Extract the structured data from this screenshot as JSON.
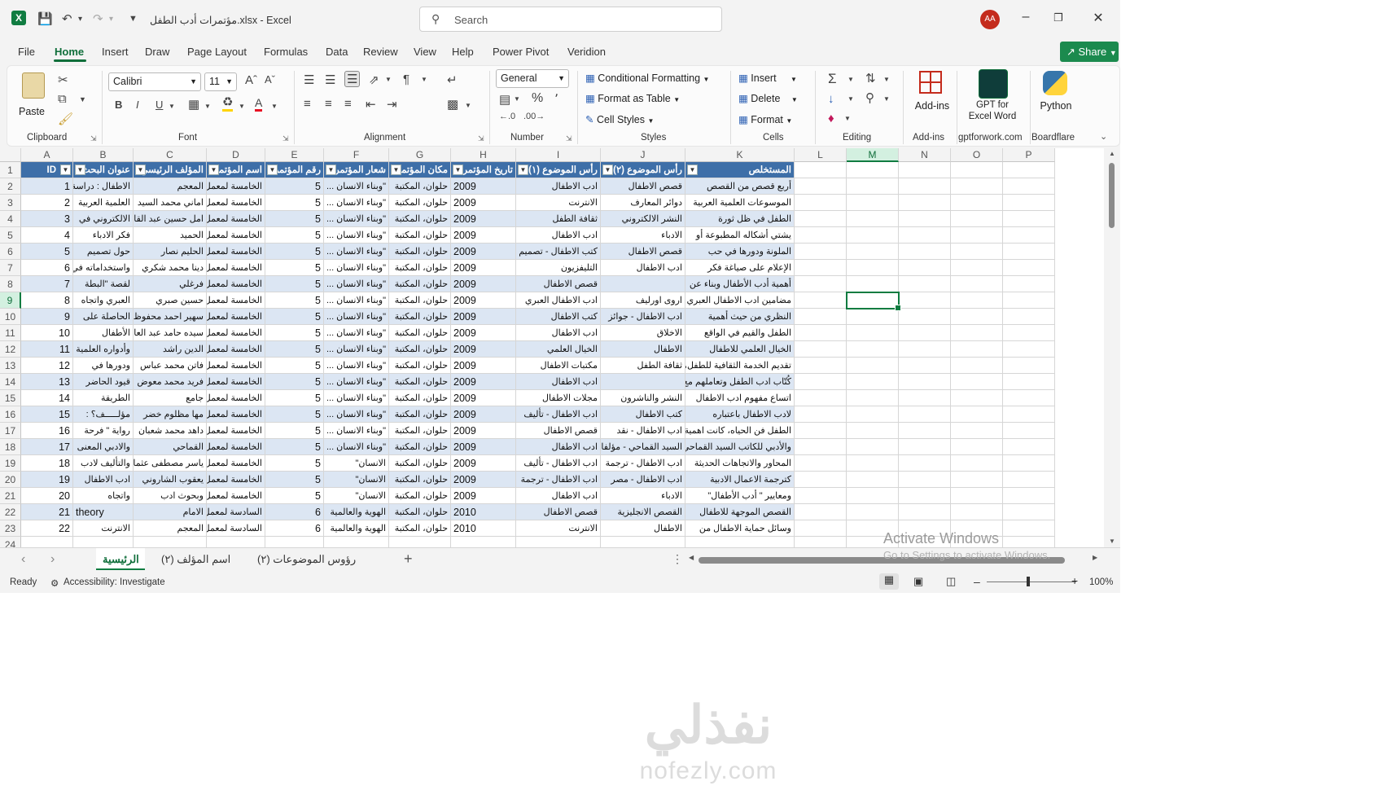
{
  "titlebar": {
    "title": "مؤتمرات أدب الطفل.xlsx  -  Excel",
    "search_placeholder": "Search",
    "avatar_initials": "AA"
  },
  "menu": [
    "File",
    "Home",
    "Insert",
    "Draw",
    "Page Layout",
    "Formulas",
    "Data",
    "Review",
    "View",
    "Help",
    "Power Pivot",
    "Veridion"
  ],
  "share_label": "Share",
  "ribbon": {
    "clipboard": {
      "paste": "Paste",
      "label": "Clipboard"
    },
    "font": {
      "name": "Calibri",
      "size": "11",
      "label": "Font"
    },
    "alignment": {
      "label": "Alignment"
    },
    "number": {
      "format": "General",
      "label": "Number"
    },
    "styles": {
      "conditional": "Conditional Formatting",
      "format_table": "Format as Table",
      "cell_styles": "Cell Styles",
      "label": "Styles"
    },
    "cells": {
      "insert": "Insert",
      "delete": "Delete",
      "format": "Format",
      "label": "Cells"
    },
    "editing": {
      "label": "Editing"
    },
    "addins": {
      "btn": "Add-ins",
      "label": "Add-ins"
    },
    "gpt": {
      "line1": "GPT for",
      "line2": "Excel Word",
      "label": "gptforwork.com"
    },
    "python": {
      "btn": "Python",
      "label": "Boardflare"
    }
  },
  "columns": [
    "A",
    "B",
    "C",
    "D",
    "E",
    "F",
    "G",
    "H",
    "I",
    "J",
    "K",
    "L",
    "M",
    "N",
    "O",
    "P"
  ],
  "headers": [
    "ID",
    "عنوان البحث",
    "المؤلف الرئيسي",
    "اسم المؤتمر",
    "رقم المؤتمر",
    "شعار المؤتمر",
    "مكان المؤتمر",
    "تاريخ المؤتمر",
    "رأس الموضوع (١)",
    "رأس الموضوع (٢)",
    "المستخلص"
  ],
  "rows": [
    [
      "1",
      "الاطفال : دراسة",
      "المعجم",
      "الخامسة لمعمل",
      "5",
      "\"وبناء الانسان ...",
      "حلوان، المكتبة",
      "2009",
      "ادب الاطفال",
      "قصص الاطفال",
      "أربع قصص من القصص"
    ],
    [
      "2",
      "العلمية العربية",
      "اماني محمد السيد",
      "الخامسة لمعمل",
      "5",
      "\"وبناء الانسان ...",
      "حلوان، المكتبة",
      "2009",
      "الانترنت",
      "دوائر المعارف",
      "الموسوعات العلمية العربية"
    ],
    [
      "3",
      "الالكتروني في",
      "امل حسين عبد القادر",
      "الخامسة لمعمل",
      "5",
      "\"وبناء الانسان ...",
      "حلوان، المكتبة",
      "2009",
      "ثقافة الطفل",
      "النشر الالكتروني",
      "الطفل في ظل ثورة"
    ],
    [
      "4",
      "فكر الادباء",
      "الحميد",
      "الخامسة لمعمل",
      "5",
      "\"وبناء الانسان ...",
      "حلوان، المكتبة",
      "2009",
      "ادب الاطفال",
      "الادباء",
      "يشتي أشكاله المطبوعة أو"
    ],
    [
      "5",
      "حول تصميم",
      "الحليم نصار",
      "الخامسة لمعمل",
      "5",
      "\"وبناء الانسان ...",
      "حلوان، المكتبة",
      "2009",
      "كتب الاطفال - تصميم",
      "قصص الاطفال",
      "الملونة ودورها في حب"
    ],
    [
      "6",
      "واستخداماته في",
      "دينا محمد شكري",
      "الخامسة لمعمل",
      "5",
      "\"وبناء الانسان ...",
      "حلوان، المكتبة",
      "2009",
      "التليفزيون",
      "ادب الاطفال",
      "الإعلام على صياغة فكر"
    ],
    [
      "7",
      "لقصة \"البطة",
      "فرغلي",
      "الخامسة لمعمل",
      "5",
      "\"وبناء الانسان ...",
      "حلوان، المكتبة",
      "2009",
      "قصص الاطفال",
      "",
      "أهمية أدب الأطفال وبناء عن"
    ],
    [
      "8",
      "العبري واتجاه",
      "حسين صبري",
      "الخامسة لمعمل",
      "5",
      "\"وبناء الانسان ...",
      "حلوان، المكتبة",
      "2009",
      "ادب الاطفال العبري",
      "اروى اورليف",
      "مضامين ادب الاطفال العبري"
    ],
    [
      "9",
      "الحاصلة على",
      "سهير احمد محفوظ",
      "الخامسة لمعمل",
      "5",
      "\"وبناء الانسان ...",
      "حلوان، المكتبة",
      "2009",
      "كتب الاطفال",
      "ادب الاطفال - جوائز",
      "النظري من حيث أهمية"
    ],
    [
      "10",
      "الأطفال",
      "سيده حامد عبد العال",
      "الخامسة لمعمل",
      "5",
      "\"وبناء الانسان ...",
      "حلوان، المكتبة",
      "2009",
      "ادب الاطفال",
      "الاخلاق",
      "الطفل والقيم في الواقع"
    ],
    [
      "11",
      "وأدواره العلمية",
      "الدين راشد",
      "الخامسة لمعمل",
      "5",
      "\"وبناء الانسان ...",
      "حلوان، المكتبة",
      "2009",
      "الخيال العلمي",
      "الاطفال",
      "الخيال العلمي للاطفال"
    ],
    [
      "12",
      "ودورها في",
      "فاتن محمد عباس",
      "الخامسة لمعمل",
      "5",
      "\"وبناء الانسان ...",
      "حلوان، المكتبة",
      "2009",
      "مكتبات الاطفال",
      "ثقافة الطفل",
      "تقديم الخدمة الثقافية للطفل،"
    ],
    [
      "13",
      "قيود الحاضر",
      "فريد محمد معوض",
      "الخامسة لمعمل",
      "5",
      "\"وبناء الانسان ...",
      "حلوان، المكتبة",
      "2009",
      "ادب الاطفال",
      "",
      "كُتّاب ادب الطفل وتعاملهم مع"
    ],
    [
      "14",
      "الطريقة",
      "جامع",
      "الخامسة لمعمل",
      "5",
      "\"وبناء الانسان ...",
      "حلوان، المكتبة",
      "2009",
      "مجلات الاطفال",
      "النشر والناشرون",
      "اتساع مفهوم ادب الاطفال"
    ],
    [
      "15",
      "مؤلـــــف؟ :",
      "مها مظلوم خضر",
      "الخامسة لمعمل",
      "5",
      "\"وبناء الانسان ...",
      "حلوان، المكتبة",
      "2009",
      "ادب الاطفال - تأليف",
      "كتب الاطفال",
      "لادب الاطفال باعتباره"
    ],
    [
      "16",
      "رواية \" فرحة",
      "داهد محمد شعبان",
      "الخامسة لمعمل",
      "5",
      "\"وبناء الانسان ...",
      "حلوان، المكتبة",
      "2009",
      "قصص الاطفال",
      "ادب الاطفال - نقد",
      "الطفل فن الحياه، كانت اهمية"
    ],
    [
      "17",
      "والادبي المعنى",
      "القماحي",
      "الخامسة لمعمل",
      "5",
      "\"وبناء الانسان ...",
      "حلوان، المكتبة",
      "2009",
      "ادب الاطفال",
      "السيد القماحي - مؤلفات",
      "والأدبي للكاتب السيد القماحي"
    ],
    [
      "18",
      "والتأليف لادب",
      "ياسر مصطفى عثمان",
      "الخامسة لمعمل",
      "5",
      "الانسان\"",
      "حلوان، المكتبة",
      "2009",
      "ادب الاطفال - تأليف",
      "ادب الاطفال - ترجمة",
      "المحاور والاتجاهات الحديثة"
    ],
    [
      "19",
      "ادب الاطفال",
      "يعقوب الشاروني",
      "الخامسة لمعمل",
      "5",
      "الانسان\"",
      "حلوان، المكتبة",
      "2009",
      "ادب الاطفال - ترجمة",
      "ادب الاطفال - مصر",
      "كترجمة الاعمال الادبية"
    ],
    [
      "20",
      "واتجاه",
      "وبحوث ادب",
      "الخامسة لمعمل",
      "5",
      "الانسان\"",
      "حلوان، المكتبة",
      "2009",
      "ادب الاطفال",
      "الادباء",
      "ومعايير \" أدب الأطفال\""
    ],
    [
      "21",
      "theory",
      "الامام",
      "السادسة لمعمل",
      "6",
      "الهوية والعالمية",
      "حلوان، المكتبة",
      "2010",
      "قصص الاطفال",
      "القصص الانجليزية",
      "القصص الموجهة للاطفال"
    ],
    [
      "22",
      "الانترنت",
      "المعجم",
      "السادسة لمعمل",
      "6",
      "الهوية والعالمية",
      "حلوان، المكتبة",
      "2010",
      "الانترنت",
      "الاطفال",
      "وسائل حماية الاطفال من"
    ]
  ],
  "sheet_tabs": [
    "الرئيسية",
    "اسم المؤلف (٢)",
    "رؤوس الموضوعات (٢)"
  ],
  "status": {
    "ready": "Ready",
    "accessibility": "Accessibility: Investigate",
    "zoom": "100%"
  },
  "watermark": {
    "line1": "Activate Windows",
    "line2": "Go to Settings to activate Windows."
  },
  "brand": {
    "arabic": "نفذلي",
    "latin": "nofezly.com"
  }
}
